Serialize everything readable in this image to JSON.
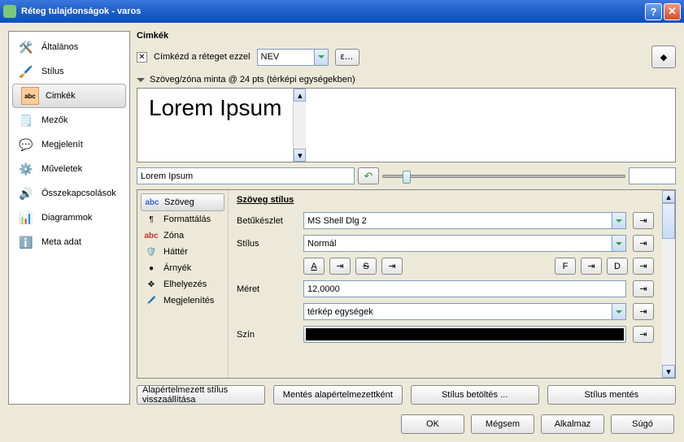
{
  "window": {
    "title": "Réteg tulajdonságok - varos"
  },
  "sidebar": {
    "items": [
      {
        "label": "Általános"
      },
      {
        "label": "Stílus"
      },
      {
        "label": "Cimkék"
      },
      {
        "label": "Mezők"
      },
      {
        "label": "Megjelenít"
      },
      {
        "label": "Műveletek"
      },
      {
        "label": "Összekapcsolások"
      },
      {
        "label": "Diagrammok"
      },
      {
        "label": "Meta adat"
      }
    ]
  },
  "header": {
    "title": "Cimkék"
  },
  "labelwith": {
    "checkbox_char": "✕",
    "text": "Címkézd a réteget ezzel",
    "field": "NEV",
    "expr_btn": "ε…"
  },
  "preview": {
    "header": "Szöveg/zóna minta @ 24 pts (térképi egységekben)",
    "sample": "Lorem Ipsum",
    "input": "Lorem Ipsum"
  },
  "styletabs": {
    "items": [
      {
        "label": "Szöveg"
      },
      {
        "label": "Formattálás"
      },
      {
        "label": "Zóna"
      },
      {
        "label": "Háttér"
      },
      {
        "label": "Árnyék"
      },
      {
        "label": "Elhelyezés"
      },
      {
        "label": "Megjelenítés"
      }
    ]
  },
  "textstyle": {
    "title": "Szöveg stílus",
    "font_label": "Betűkészlet",
    "font_value": "MS Shell Dlg 2",
    "style_label": "Stílus",
    "style_value": "Normál",
    "underline_btn": "A",
    "strike_btn": "S",
    "f_btn": "F",
    "d_btn": "D",
    "size_label": "Méret",
    "size_value": "12,0000",
    "unit_value": "térkép egységek",
    "color_label": "Szín"
  },
  "bottom": {
    "restore": "Alapértelmezett stílus visszaállítása",
    "save_default": "Mentés alapértelmezettként",
    "load_style": "Stílus betöltés ...",
    "save_style": "Stílus mentés"
  },
  "dialog": {
    "ok": "OK",
    "cancel": "Mégsem",
    "apply": "Alkalmaz",
    "help": "Súgó"
  }
}
